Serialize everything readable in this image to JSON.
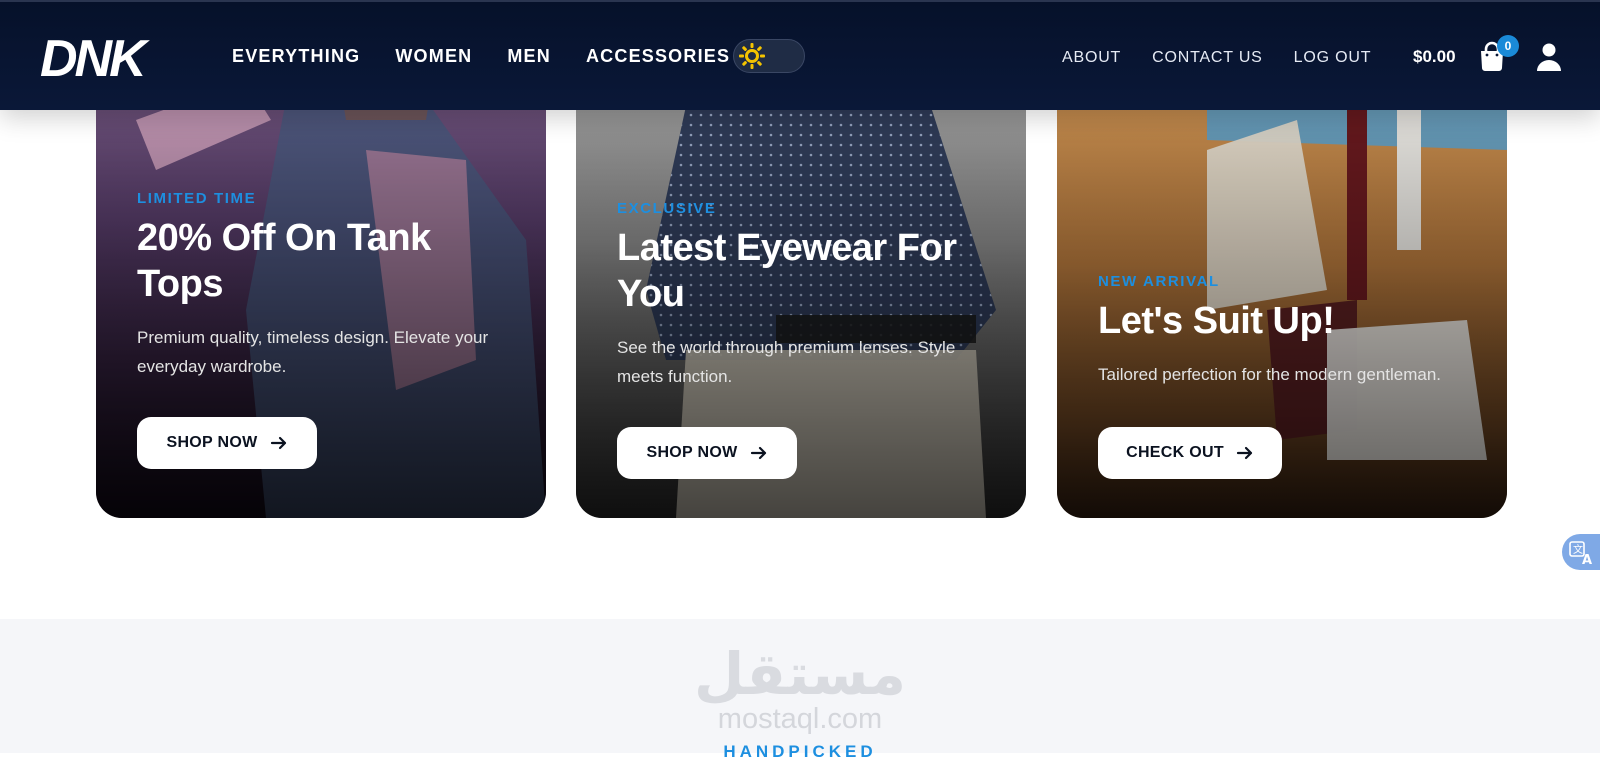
{
  "header": {
    "logo_text": "DNK",
    "nav_main": [
      "EVERYTHING",
      "WOMEN",
      "MEN",
      "ACCESSORIES"
    ],
    "nav_right": [
      "ABOUT",
      "CONTACT US",
      "LOG OUT"
    ],
    "cart_total": "$0.00",
    "cart_count": "0",
    "theme_icon": "sun-icon",
    "cart_icon": "shopping-bag-icon",
    "user_icon": "user-icon"
  },
  "cards": [
    {
      "eyebrow": "LIMITED TIME",
      "title": "20% Off On Tank Tops",
      "description": "Premium quality, timeless design. Elevate your everyday wardrobe.",
      "cta": "SHOP NOW"
    },
    {
      "eyebrow": "EXCLUSIVE",
      "title": "Latest Eyewear For You",
      "description": "See the world through premium lenses. Style meets function.",
      "cta": "SHOP NOW"
    },
    {
      "eyebrow": "NEW ARRIVAL",
      "title": "Let's Suit Up!",
      "description": "Tailored perfection for the modern gentleman.",
      "cta": "CHECK OUT"
    }
  ],
  "watermark": {
    "arabic": "مستقل",
    "latin": "mostaql.com"
  },
  "section": {
    "eyebrow": "HANDPICKED"
  },
  "colors": {
    "header_bg": "#06112a",
    "accent": "#1d8fe0",
    "badge": "#1a8ad8"
  }
}
